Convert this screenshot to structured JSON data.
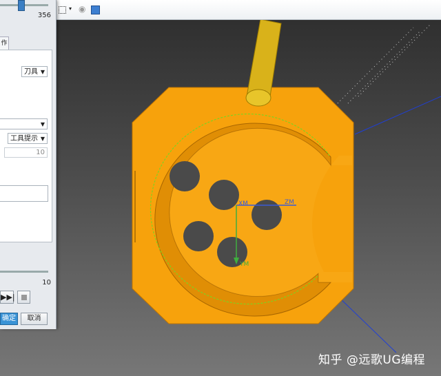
{
  "panel": {
    "slider_value": "356",
    "tab_label": "作",
    "tool_dropdown": "刀具",
    "select_dropdown": "",
    "tip_dropdown": "工具提示",
    "number_field": "10",
    "speed_value": "10",
    "ok_label": "确定",
    "cancel_label": "取消"
  },
  "viewport": {
    "axes": {
      "xm": "XM",
      "zm": "ZM",
      "ym": "YM"
    },
    "colors": {
      "part": "#f7a20c",
      "tool": "#d9b21a",
      "toolpath": "#7ed321",
      "axis_x": "#3b5bd6",
      "axis_y": "#3fae3f"
    }
  },
  "watermark": "知乎 @远歌UG编程"
}
